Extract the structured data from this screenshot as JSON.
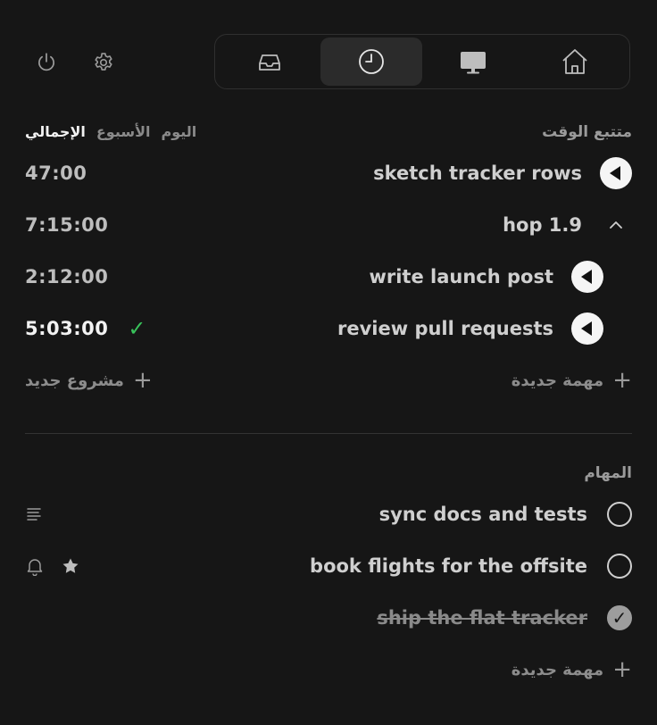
{
  "tracker": {
    "title": "متتبع الوقت",
    "tabs": [
      "الإجمالي",
      "الأسبوع",
      "اليوم"
    ],
    "rows": [
      {
        "time": "47:00",
        "name": "sketch tracker rows"
      },
      {
        "time": "7:15:00",
        "name": "hop 1.9"
      },
      {
        "time": "2:12:00",
        "name": "write launch post"
      },
      {
        "time": "5:03:00",
        "name": "review pull requests"
      }
    ],
    "new_project": "مشروع جديد",
    "new_task": "مهمة جديدة"
  },
  "tasks": {
    "title": "المهام",
    "items": [
      {
        "name": "sync docs and tests",
        "done": false
      },
      {
        "name": "book flights for the offsite",
        "done": false
      },
      {
        "name": "ship the flat tracker",
        "done": true
      }
    ],
    "new_task": "مهمة جديدة"
  },
  "colors": {
    "background": "#161616",
    "accent_check": "#38c25a"
  },
  "icons": {
    "top": [
      "power-icon",
      "gear-icon"
    ],
    "nav": [
      "inbox-icon",
      "clock-icon",
      "monitor-icon",
      "home-icon"
    ]
  }
}
